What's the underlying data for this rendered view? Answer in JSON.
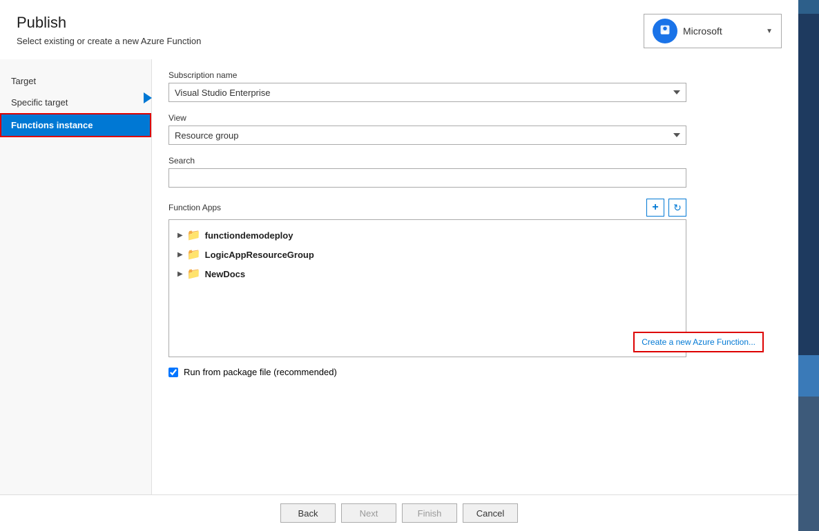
{
  "header": {
    "title": "Publish",
    "subtitle": "Select existing or create a new Azure Function",
    "account": {
      "name": "Microsoft",
      "icon_label": "👤"
    }
  },
  "nav": {
    "items": [
      {
        "id": "target",
        "label": "Target",
        "active": false
      },
      {
        "id": "specific-target",
        "label": "Specific target",
        "active": false
      },
      {
        "id": "functions-instance",
        "label": "Functions instance",
        "active": true
      }
    ]
  },
  "form": {
    "subscription_label": "Subscription name",
    "subscription_value": "Visual Studio Enterprise",
    "view_label": "View",
    "view_value": "Resource group",
    "search_label": "Search",
    "search_placeholder": "",
    "function_apps_label": "Function Apps",
    "create_tooltip": "Create a new Azure Function...",
    "tree_items": [
      {
        "id": 1,
        "label": "functiondemodeploy"
      },
      {
        "id": 2,
        "label": "LogicAppResourceGroup"
      },
      {
        "id": 3,
        "label": "NewDocs"
      }
    ],
    "checkbox_label": "Run from package file (recommended)",
    "checkbox_checked": true
  },
  "footer": {
    "back_label": "Back",
    "next_label": "Next",
    "finish_label": "Finish",
    "cancel_label": "Cancel"
  }
}
